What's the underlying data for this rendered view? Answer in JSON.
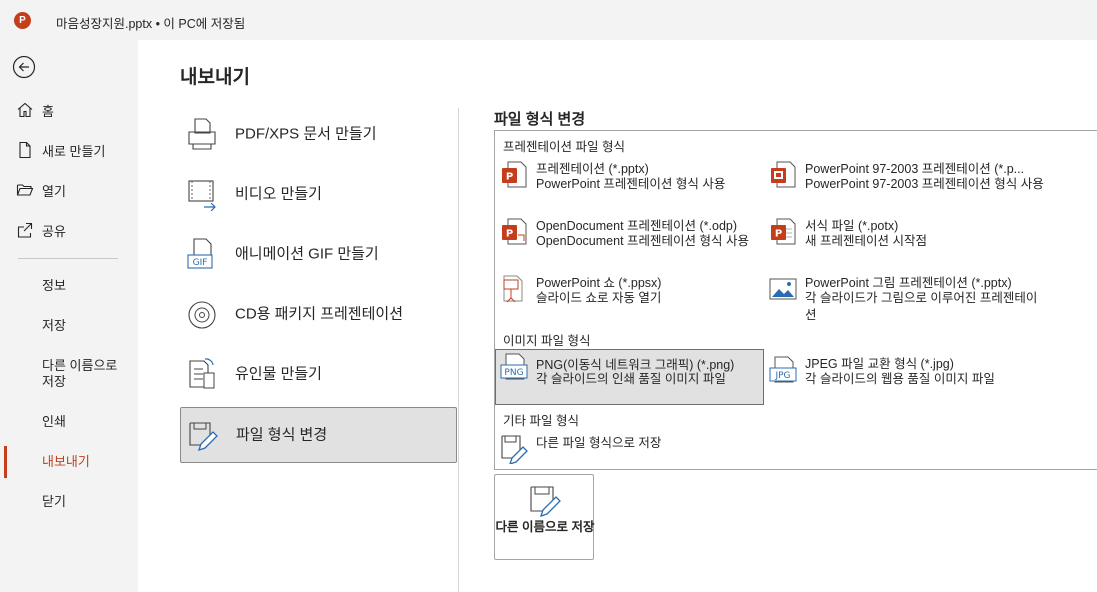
{
  "app": {
    "logo_letter": "P",
    "accent": "#c43e1c"
  },
  "title_bar": {
    "document_title": "마음성장지원.pptx • 이 PC에 저장됨"
  },
  "nav": {
    "items": [
      {
        "label": "홈",
        "icon": "home-icon"
      },
      {
        "label": "새로 만들기",
        "icon": "new-document-icon"
      },
      {
        "label": "열기",
        "icon": "open-folder-icon"
      },
      {
        "label": "공유",
        "icon": "share-icon"
      },
      {
        "label": "정보"
      },
      {
        "label": "저장"
      },
      {
        "label": "다른 이름으로 저장"
      },
      {
        "label": "인쇄"
      },
      {
        "label": "내보내기",
        "active": true
      },
      {
        "label": "닫기"
      }
    ]
  },
  "main": {
    "page_title": "내보내기",
    "export_options": [
      {
        "label": "PDF/XPS 문서 만들기",
        "icon": "pdf-document-icon"
      },
      {
        "label": "비디오 만들기",
        "icon": "video-icon"
      },
      {
        "label": "애니메이션 GIF 만들기",
        "icon": "gif-icon"
      },
      {
        "label": "CD용 패키지 프레젠테이션",
        "icon": "cd-package-icon"
      },
      {
        "label": "유인물 만들기",
        "icon": "handouts-icon"
      },
      {
        "label": "파일 형식 변경",
        "icon": "change-file-type-icon",
        "selected": true
      }
    ]
  },
  "right": {
    "section_title": "파일 형식 변경",
    "groups": {
      "presentation": "프레젠테이션 파일 형식",
      "image": "이미지 파일 형식",
      "other": "기타 파일 형식"
    },
    "file_types": {
      "pptx": {
        "title": "프레젠테이션 (*.pptx)",
        "desc": "PowerPoint 프레젠테이션 형식 사용"
      },
      "ppt": {
        "title": "PowerPoint 97-2003 프레젠테이션 (*.p...",
        "desc": "PowerPoint 97-2003 프레젠테이션 형식 사용"
      },
      "odp": {
        "title": "OpenDocument 프레젠테이션 (*.odp)",
        "desc": "OpenDocument 프레젠테이션 형식 사용"
      },
      "potx": {
        "title": "서식 파일 (*.potx)",
        "desc": "새 프레젠테이션 시작점"
      },
      "ppsx": {
        "title": "PowerPoint 쇼 (*.ppsx)",
        "desc": "슬라이드 쇼로 자동 열기"
      },
      "picture_pptx": {
        "title": "PowerPoint 그림 프레젠테이션 (*.pptx)",
        "desc": "각 슬라이드가 그림으로 이루어진 프레젠테이션"
      },
      "png": {
        "title": "PNG(이동식 네트워크 그래픽) (*.png)",
        "desc": "각 슬라이드의 인쇄 품질 이미지 파일",
        "icon_text": "PNG",
        "selected": true
      },
      "jpg": {
        "title": "JPEG 파일 교환 형식 (*.jpg)",
        "desc": "각 슬라이드의 웹용 품질 이미지 파일",
        "icon_text": "JPG"
      },
      "other": {
        "title": "다른 파일 형식으로 저장"
      }
    },
    "save_as_button": {
      "label": "다른 이름으로 저장",
      "icon": "save-as-icon"
    }
  }
}
